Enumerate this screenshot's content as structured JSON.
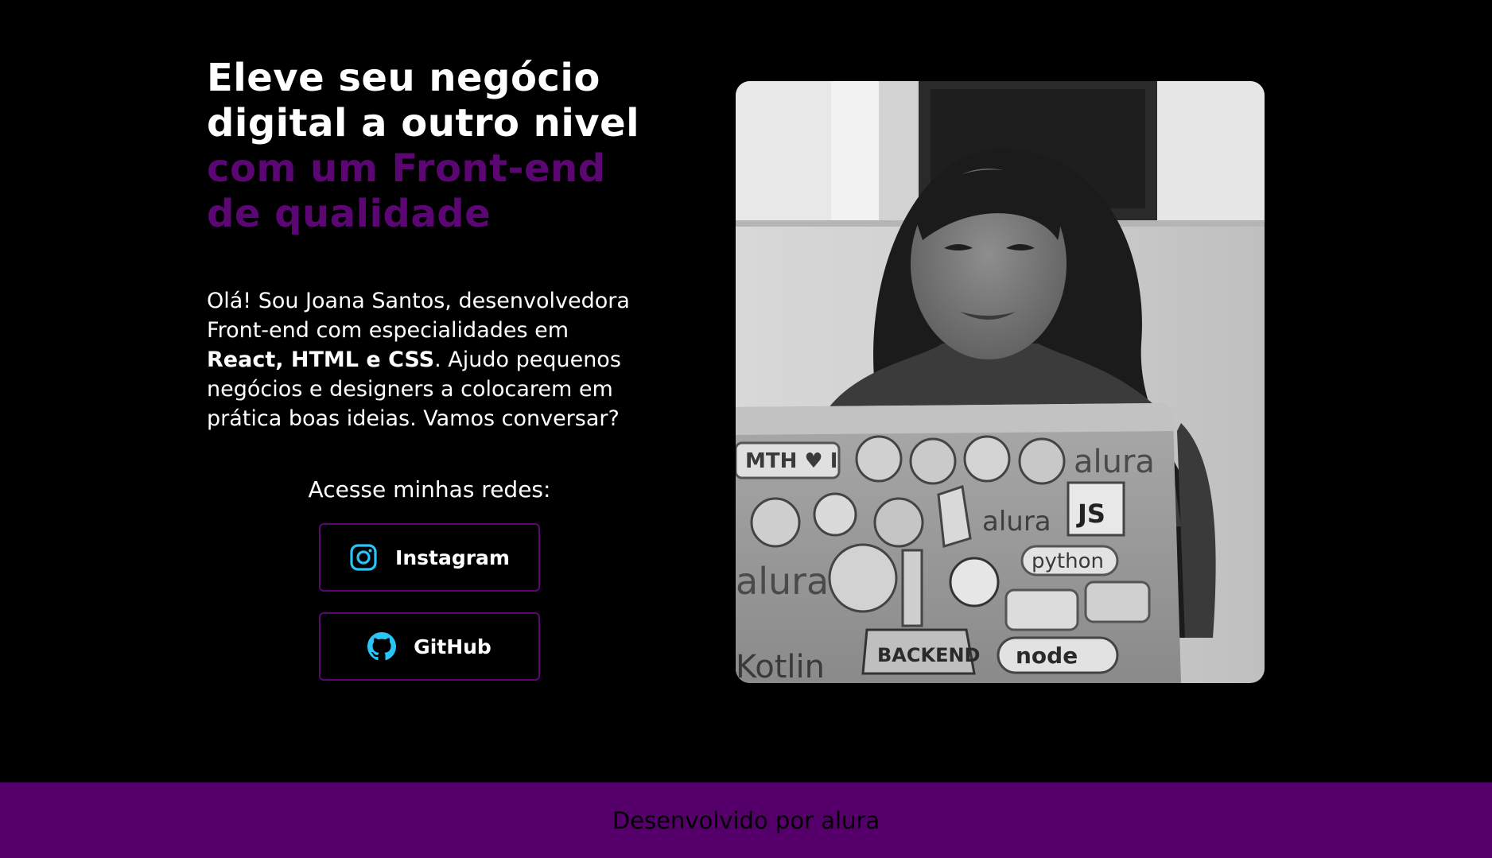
{
  "hero": {
    "headline": {
      "line1": "Eleve seu negócio",
      "line2": "digital a outro nivel",
      "line3": "com um Front-end",
      "line4": "de qualidade"
    },
    "bio": {
      "part1": "Olá! Sou Joana Santos, desenvolvedora Front-end com especialidades em ",
      "strong1": "React, HTML e CSS",
      "part2": ". Ajudo pequenos negócios e designers a colocarem em prática boas ideias. Vamos conversar?"
    },
    "social": {
      "title": "Acesse minhas redes:",
      "buttons": [
        {
          "label": "Instagram",
          "icon": "instagram-icon"
        },
        {
          "label": "GitHub",
          "icon": "github-icon"
        }
      ]
    },
    "photo": {
      "stickers": {
        "mth": "MTH ♥ I",
        "alura1": "alura",
        "js": "JS",
        "alura2": "alura",
        "python": "python",
        "alura3": "alura",
        "backend": "BACKEND",
        "node": "node",
        "kotlin": "Kotlin"
      }
    }
  },
  "footer": {
    "text": "Desenvolvido por alura"
  },
  "colors": {
    "background": "#000000",
    "accent_purple": "#5c0673",
    "footer_bg": "#55006a",
    "icon_cyan": "#29c5f6"
  }
}
